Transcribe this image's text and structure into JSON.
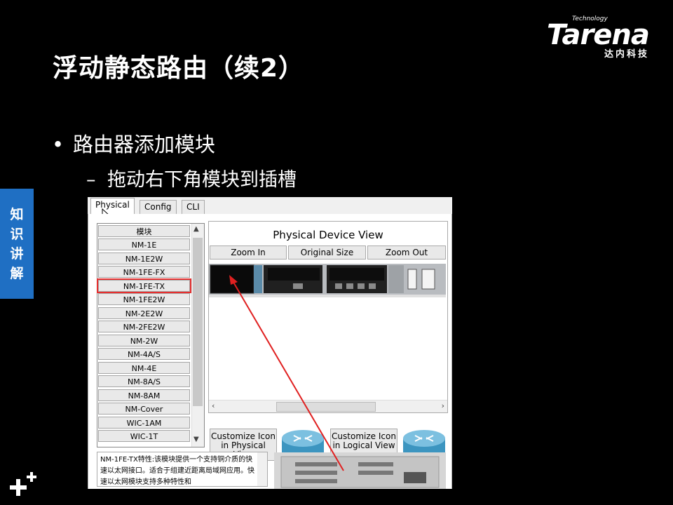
{
  "slide": {
    "title": "浮动静态路由（续2）",
    "bullet_level1": "路由器添加模块",
    "bullet_level2": "拖动右下角模块到插槽",
    "bullet_symbol": "•",
    "dash_symbol": "–"
  },
  "brand": {
    "logo_text": "Tarena",
    "logo_superscript": "Technology",
    "logo_cn": "达内科技"
  },
  "side_tab": {
    "chars": [
      "知",
      "识",
      "讲",
      "解"
    ]
  },
  "app": {
    "tabs": [
      {
        "label": "Physical",
        "active": true
      },
      {
        "label": "Config",
        "active": false
      },
      {
        "label": "CLI",
        "active": false
      }
    ],
    "module_list": {
      "header": "模块",
      "items": [
        "NM-1E",
        "NM-1E2W",
        "NM-1FE-FX",
        "NM-1FE-TX",
        "NM-1FE2W",
        "NM-2E2W",
        "NM-2FE2W",
        "NM-2W",
        "NM-4A/S",
        "NM-4E",
        "NM-8A/S",
        "NM-8AM",
        "NM-Cover",
        "WIC-1AM",
        "WIC-1T"
      ],
      "selected": "NM-1FE-TX"
    },
    "device_view": {
      "title": "Physical Device View",
      "zoom_in": "Zoom In",
      "original_size": "Original Size",
      "zoom_out": "Zoom Out"
    },
    "customize_physical": "Customize Icon in Physical View",
    "customize_logical": "Customize Icon in Logical View",
    "description": "NM-1FE-TX特性:该模块提供一个支持铜介质的快速以太网接口。适合于组建近距离局域网应用。快速以太网模块支持多种特性和"
  },
  "colors": {
    "accent_blue": "#1f6fc3",
    "highlight_red": "#e53030"
  }
}
